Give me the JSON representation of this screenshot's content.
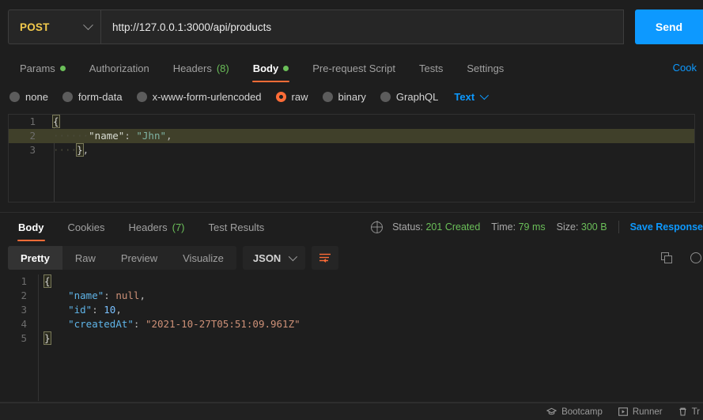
{
  "request": {
    "method": "POST",
    "method_chevron_icon": "chevron-down-icon",
    "url": "http://127.0.0.1:3000/api/products",
    "send_label": "Send",
    "cookies_link": "Cook",
    "tabs": [
      {
        "label": "Params",
        "badge": "",
        "dot": true,
        "active": false
      },
      {
        "label": "Authorization",
        "badge": "",
        "dot": false,
        "active": false
      },
      {
        "label": "Headers",
        "badge": "(8)",
        "dot": false,
        "active": false
      },
      {
        "label": "Body",
        "badge": "",
        "dot": true,
        "active": true
      },
      {
        "label": "Pre-request Script",
        "badge": "",
        "dot": false,
        "active": false
      },
      {
        "label": "Tests",
        "badge": "",
        "dot": false,
        "active": false
      },
      {
        "label": "Settings",
        "badge": "",
        "dot": false,
        "active": false
      }
    ],
    "body_types": [
      {
        "label": "none",
        "selected": false
      },
      {
        "label": "form-data",
        "selected": false
      },
      {
        "label": "x-www-form-urlencoded",
        "selected": false
      },
      {
        "label": "raw",
        "selected": true
      },
      {
        "label": "binary",
        "selected": false
      },
      {
        "label": "GraphQL",
        "selected": false
      }
    ],
    "raw_format": "Text",
    "raw_format_chevron_icon": "chevron-down-icon",
    "editor_lines": [
      {
        "no": "1",
        "text": "{",
        "highlight": false
      },
      {
        "no": "2",
        "text": "    \"name\": \"Jhn\",",
        "highlight": true
      },
      {
        "no": "3",
        "text": "    },",
        "highlight": false
      }
    ],
    "body_key": "\"name\"",
    "body_value": "\"Jhn\"",
    "body_indent": "······",
    "body_indent3": "····"
  },
  "response": {
    "tabs": [
      {
        "label": "Body",
        "badge": "",
        "active": true
      },
      {
        "label": "Cookies",
        "badge": "",
        "active": false
      },
      {
        "label": "Headers",
        "badge": "(7)",
        "active": false
      },
      {
        "label": "Test Results",
        "badge": "",
        "active": false
      }
    ],
    "globe_icon": "globe-icon",
    "status_label": "Status:",
    "status_value": "201 Created",
    "time_label": "Time:",
    "time_value": "79 ms",
    "size_label": "Size:",
    "size_value": "300 B",
    "save_response": "Save Response",
    "view_modes": [
      {
        "label": "Pretty",
        "active": true
      },
      {
        "label": "Raw",
        "active": false
      },
      {
        "label": "Preview",
        "active": false
      },
      {
        "label": "Visualize",
        "active": false
      }
    ],
    "format": "JSON",
    "format_chevron_icon": "chevron-down-icon",
    "wrap_icon": "word-wrap-icon",
    "copy_icon": "copy-icon",
    "search_icon": "search-icon",
    "lines": [
      {
        "no": "1"
      },
      {
        "no": "2"
      },
      {
        "no": "3"
      },
      {
        "no": "4"
      },
      {
        "no": "5"
      }
    ],
    "json": {
      "name_key": "\"name\"",
      "name_value": "null",
      "id_key": "\"id\"",
      "id_value": "10",
      "created_key": "\"createdAt\"",
      "created_value": "\"2021-10-27T05:51:09.961Z\""
    }
  },
  "footer": {
    "items": [
      {
        "label": "Bootcamp",
        "icon": "graduation-cap-icon"
      },
      {
        "label": "Runner",
        "icon": "play-square-icon"
      },
      {
        "label": "Tr",
        "icon": "trash-icon"
      }
    ]
  },
  "colors": {
    "accent_orange": "#ff6c37",
    "link_blue": "#0d99ff",
    "success_green": "#6bbf59",
    "method_yellow": "#f2c94c",
    "bg": "#1e1e1e"
  }
}
